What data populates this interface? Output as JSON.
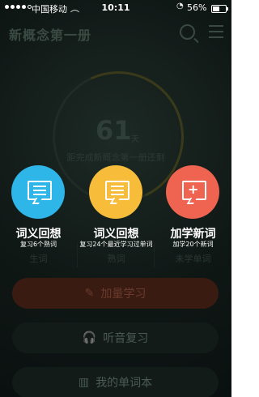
{
  "status": {
    "carrier": "中国移动",
    "time": "10:11",
    "battery": "56%"
  },
  "header": {
    "title": "新概念第一册"
  },
  "progress": {
    "days": "61",
    "unit": "天",
    "caption": "距完成新概念第一册还剩"
  },
  "cards": [
    {
      "title": "词义回想",
      "subtitle": "复习6个熟词",
      "tag": "生词"
    },
    {
      "title": "词义回想",
      "subtitle": "复习24个最近学习过单词",
      "tag": "熟词"
    },
    {
      "title": "加学新词",
      "subtitle": "加学20个新词",
      "tag": "未学单词"
    }
  ],
  "buttons": [
    {
      "label": "加量学习",
      "icon": "pencil-icon"
    },
    {
      "label": "听音复习",
      "icon": "headphones-icon"
    },
    {
      "label": "我的单词本",
      "icon": "book-icon"
    }
  ]
}
